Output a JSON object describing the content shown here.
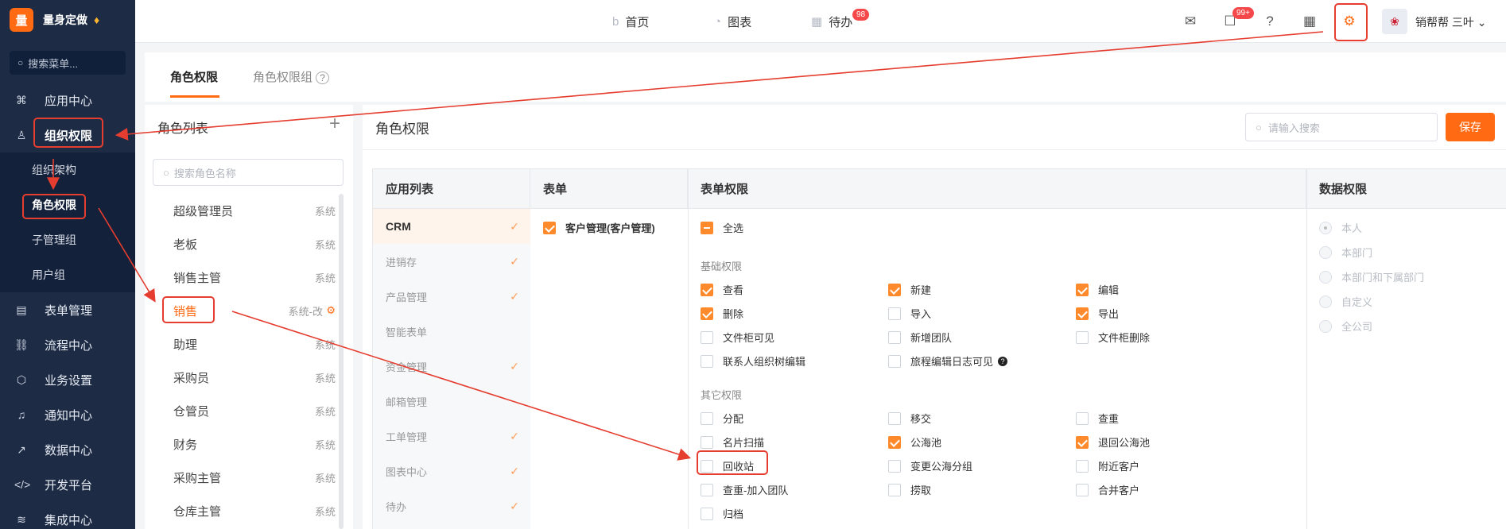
{
  "brand": {
    "logo": "量",
    "name": "量身定做"
  },
  "sidebar": {
    "search_placeholder": "搜索菜单...",
    "items": [
      {
        "label": "应用中心",
        "icon": "grid-icon"
      },
      {
        "label": "组织权限",
        "icon": "user-icon"
      },
      {
        "label": "表单管理",
        "icon": "form-icon"
      },
      {
        "label": "流程中心",
        "icon": "flow-icon"
      },
      {
        "label": "业务设置",
        "icon": "cube-icon"
      },
      {
        "label": "通知中心",
        "icon": "bell-icon"
      },
      {
        "label": "数据中心",
        "icon": "chart-icon"
      },
      {
        "label": "开发平台",
        "icon": "code-icon"
      },
      {
        "label": "集成中心",
        "icon": "layers-icon"
      }
    ],
    "sub_items": [
      "组织架构",
      "角色权限",
      "子管理组",
      "用户组"
    ]
  },
  "topbar": {
    "tabs": [
      {
        "label": "首页",
        "icon": "home-icon"
      },
      {
        "label": "图表",
        "icon": "pie-icon"
      },
      {
        "label": "待办",
        "icon": "calendar-icon",
        "badge": "98"
      }
    ],
    "message_badge": "99+",
    "user_name": "销帮帮 三叶"
  },
  "page_tabs": [
    "角色权限",
    "角色权限组"
  ],
  "role_panel": {
    "title": "角色列表",
    "search_placeholder": "搜索角色名称",
    "roles": [
      {
        "name": "超级管理员",
        "tag": "系统"
      },
      {
        "name": "老板",
        "tag": "系统"
      },
      {
        "name": "销售主管",
        "tag": "系统"
      },
      {
        "name": "销售",
        "tag": "系统-改"
      },
      {
        "name": "助理",
        "tag": "系统"
      },
      {
        "name": "采购员",
        "tag": "系统"
      },
      {
        "name": "仓管员",
        "tag": "系统"
      },
      {
        "name": "财务",
        "tag": "系统"
      },
      {
        "name": "采购主管",
        "tag": "系统"
      },
      {
        "name": "仓库主管",
        "tag": "系统"
      }
    ]
  },
  "main_panel": {
    "title": "角色权限",
    "search_placeholder": "请输入搜索",
    "save_label": "保存",
    "headers": [
      "应用列表",
      "表单",
      "表单权限",
      "数据权限"
    ],
    "apps": [
      "CRM",
      "进销存",
      "产品管理",
      "智能表单",
      "资金管理",
      "邮箱管理",
      "工单管理",
      "图表中心",
      "待办"
    ],
    "form_item": "客户管理(客户管理)",
    "select_all": "全选",
    "basic_label": "基础权限",
    "basic_perms": [
      "查看",
      "新建",
      "编辑",
      "删除",
      "导入",
      "导出",
      "文件柜可见",
      "新增团队",
      "文件柜删除",
      "联系人组织树编辑",
      "旅程编辑日志可见"
    ],
    "other_label": "其它权限",
    "other_perms": [
      "分配",
      "移交",
      "查重",
      "名片扫描",
      "公海池",
      "退回公海池",
      "回收站",
      "变更公海分组",
      "附近客户",
      "查重-加入团队",
      "捞取",
      "合并客户",
      "归档"
    ],
    "data_perms": [
      "本人",
      "本部门",
      "本部门和下属部门",
      "自定义",
      "全公司"
    ]
  }
}
